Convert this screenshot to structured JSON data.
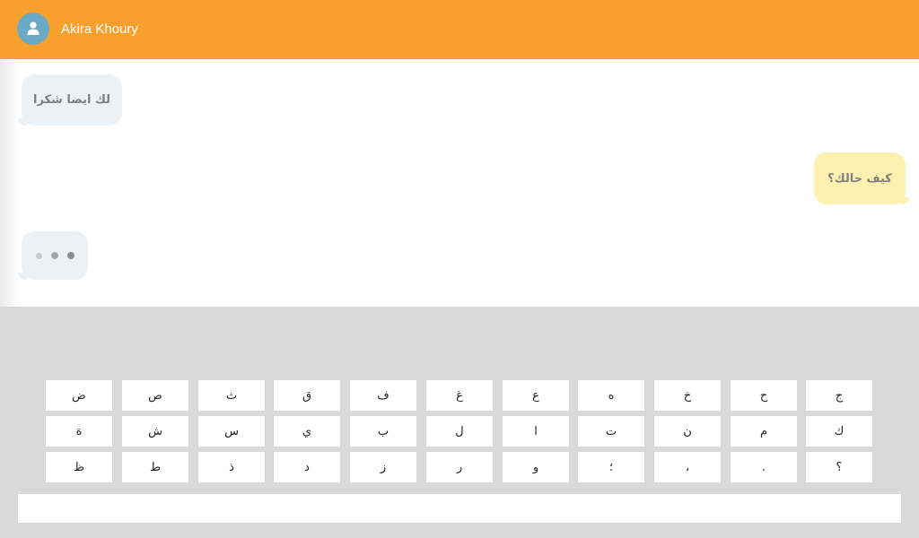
{
  "header": {
    "contact_name": "Akira Khoury",
    "avatar_icon": "user-icon",
    "background_color": "#f7a02e"
  },
  "messages": [
    {
      "direction": "incoming",
      "text": "لك ايضا شكرا"
    },
    {
      "direction": "outgoing",
      "text": "كيف حالك؟"
    },
    {
      "direction": "incoming",
      "typing": true
    }
  ],
  "keyboard": {
    "rows": [
      [
        "ج",
        "ح",
        "خ",
        "ه",
        "ع",
        "غ",
        "ف",
        "ق",
        "ث",
        "ص",
        "ض"
      ],
      [
        "ك",
        "م",
        "ن",
        "ت",
        "ا",
        "ل",
        "ب",
        "ي",
        "س",
        "ش",
        "ة"
      ],
      [
        "؟",
        ".",
        "،",
        "؛",
        "و",
        "ر",
        "ز",
        "د",
        "ذ",
        "ط",
        "ظ"
      ]
    ]
  },
  "input": {
    "value": "",
    "placeholder": ""
  }
}
